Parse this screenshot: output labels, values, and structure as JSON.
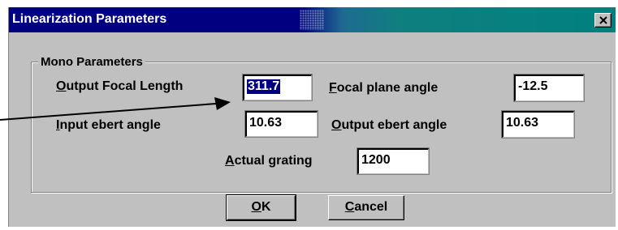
{
  "window": {
    "title": "Linearization Parameters",
    "close_glyph": "✕"
  },
  "group": {
    "label": "Mono Parameters"
  },
  "fields": {
    "output_focal_length": {
      "mnemonic": "O",
      "label_rest": "utput Focal Length",
      "value": "311.7"
    },
    "focal_plane_angle": {
      "mnemonic": "F",
      "label_rest": "ocal plane angle",
      "value": "-12.5"
    },
    "input_ebert_angle": {
      "mnemonic": "I",
      "label_rest": "nput ebert angle",
      "value": "10.63"
    },
    "output_ebert_angle": {
      "mnemonic": "O",
      "label_rest": "utput ebert angle",
      "value": "10.63"
    },
    "actual_grating": {
      "mnemonic": "A",
      "label_rest": "ctual grating",
      "value": "1200"
    }
  },
  "buttons": {
    "ok": {
      "mnemonic": "O",
      "label_rest": "K"
    },
    "cancel": {
      "mnemonic": "C",
      "label_rest": "ancel"
    }
  },
  "annotation": {
    "icon": "arrow-icon"
  },
  "colors": {
    "title_start": "#000080",
    "title_end": "#008080",
    "face": "#c0c0c0",
    "selection": "#000080"
  }
}
